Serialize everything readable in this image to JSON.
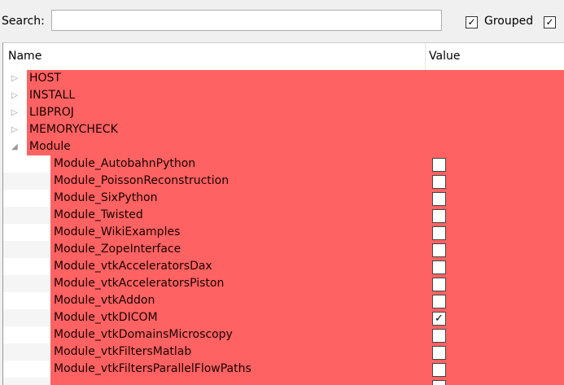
{
  "search": {
    "label": "Search:",
    "value": "",
    "placeholder": ""
  },
  "options": {
    "grouped_label": "Grouped",
    "grouped_checked": true,
    "advanced_checked": true
  },
  "table": {
    "columns": [
      "Name",
      "Value"
    ],
    "highlight_color": "#ff6262",
    "groups": [
      {
        "label": "HOST",
        "expanded": false
      },
      {
        "label": "INSTALL",
        "expanded": false
      },
      {
        "label": "LIBPROJ",
        "expanded": false
      },
      {
        "label": "MEMORYCHECK",
        "expanded": false
      },
      {
        "label": "Module",
        "expanded": true
      }
    ],
    "module_entries": [
      {
        "name": "Module_AutobahnPython",
        "checked": false
      },
      {
        "name": "Module_PoissonReconstruction",
        "checked": false
      },
      {
        "name": "Module_SixPython",
        "checked": false
      },
      {
        "name": "Module_Twisted",
        "checked": false
      },
      {
        "name": "Module_WikiExamples",
        "checked": false
      },
      {
        "name": "Module_ZopeInterface",
        "checked": false
      },
      {
        "name": "Module_vtkAcceleratorsDax",
        "checked": false
      },
      {
        "name": "Module_vtkAcceleratorsPiston",
        "checked": false
      },
      {
        "name": "Module_vtkAddon",
        "checked": false
      },
      {
        "name": "Module_vtkDICOM",
        "checked": true
      },
      {
        "name": "Module_vtkDomainsMicroscopy",
        "checked": false
      },
      {
        "name": "Module_vtkFiltersMatlab",
        "checked": false
      },
      {
        "name": "Module_vtkFiltersParallelFlowPaths",
        "checked": false
      }
    ]
  }
}
